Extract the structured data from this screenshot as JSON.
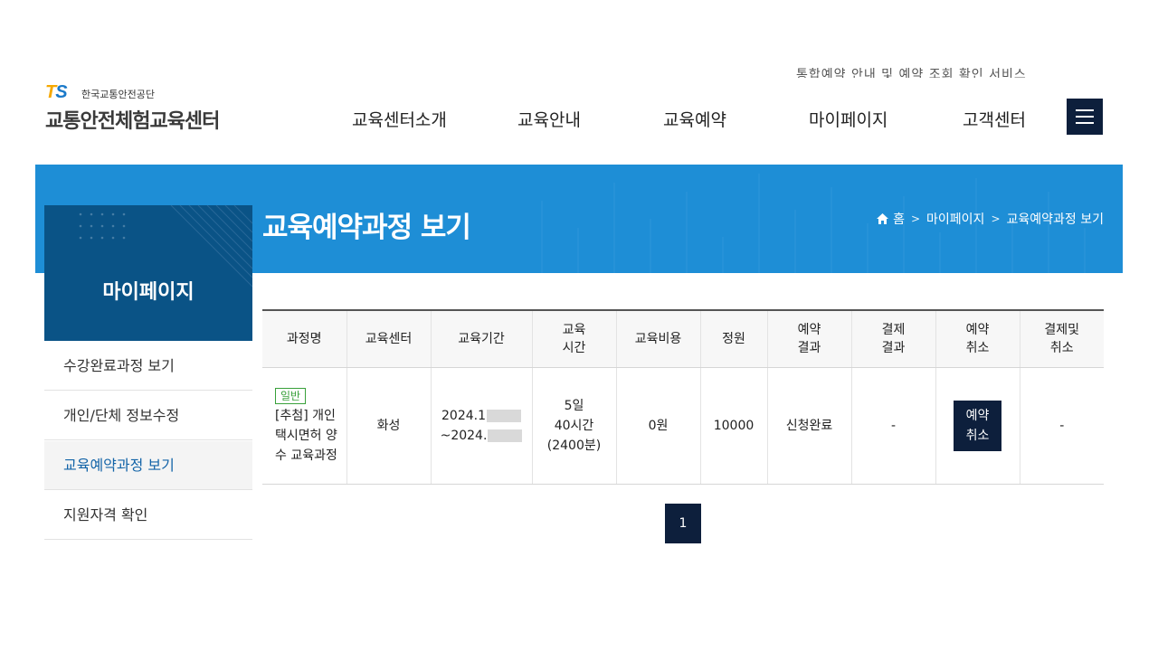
{
  "header": {
    "top_cut_text": "통합예약 안내 및 예약 조회 확인 서비스",
    "logo_mark": "TS",
    "logo_subtitle": "한국교통안전공단",
    "logo_title": "교통안전체험교육센터",
    "nav": [
      "교육센터소개",
      "교육안내",
      "교육예약",
      "마이페이지",
      "고객센터"
    ],
    "menu_icon": "hamburger-icon"
  },
  "banner": {
    "title": "교육예약과정 보기",
    "breadcrumb": [
      "홈",
      "마이페이지",
      "교육예약과정 보기"
    ],
    "home_icon": "home-icon",
    "color": "#1e8ed6"
  },
  "sidebar": {
    "title": "마이페이지",
    "items": [
      {
        "label": "수강완료과정 보기"
      },
      {
        "label": "개인/단체 정보수정"
      },
      {
        "label": "교육예약과정 보기"
      },
      {
        "label": "지원자격 확인"
      }
    ],
    "active_index": 2
  },
  "table": {
    "headers": [
      "과정명",
      "교육센터",
      "교육기간",
      "교육\n시간",
      "교육비용",
      "정원",
      "예약\n결과",
      "결제\n결과",
      "예약\n취소",
      "결제및\n취소"
    ],
    "row": {
      "badge": "일반",
      "course": "[추첨] 개인택시면허 양수 교육과정",
      "center": "화성",
      "period_start": "2024.1",
      "period_end": "~2024.",
      "days": "5일",
      "hours": "40시간",
      "minutes": "(2400분)",
      "fee": "0원",
      "capacity": "10000",
      "reservation_result": "신청완료",
      "payment_result": "-",
      "cancel_button": "예약\n취소",
      "payment_cancel": "-"
    }
  },
  "pagination": {
    "current": "1"
  },
  "colors": {
    "navy": "#0d1f3c",
    "side_blue": "#0a5386",
    "badge_green": "#38a03a",
    "active_text": "#1364a8"
  }
}
